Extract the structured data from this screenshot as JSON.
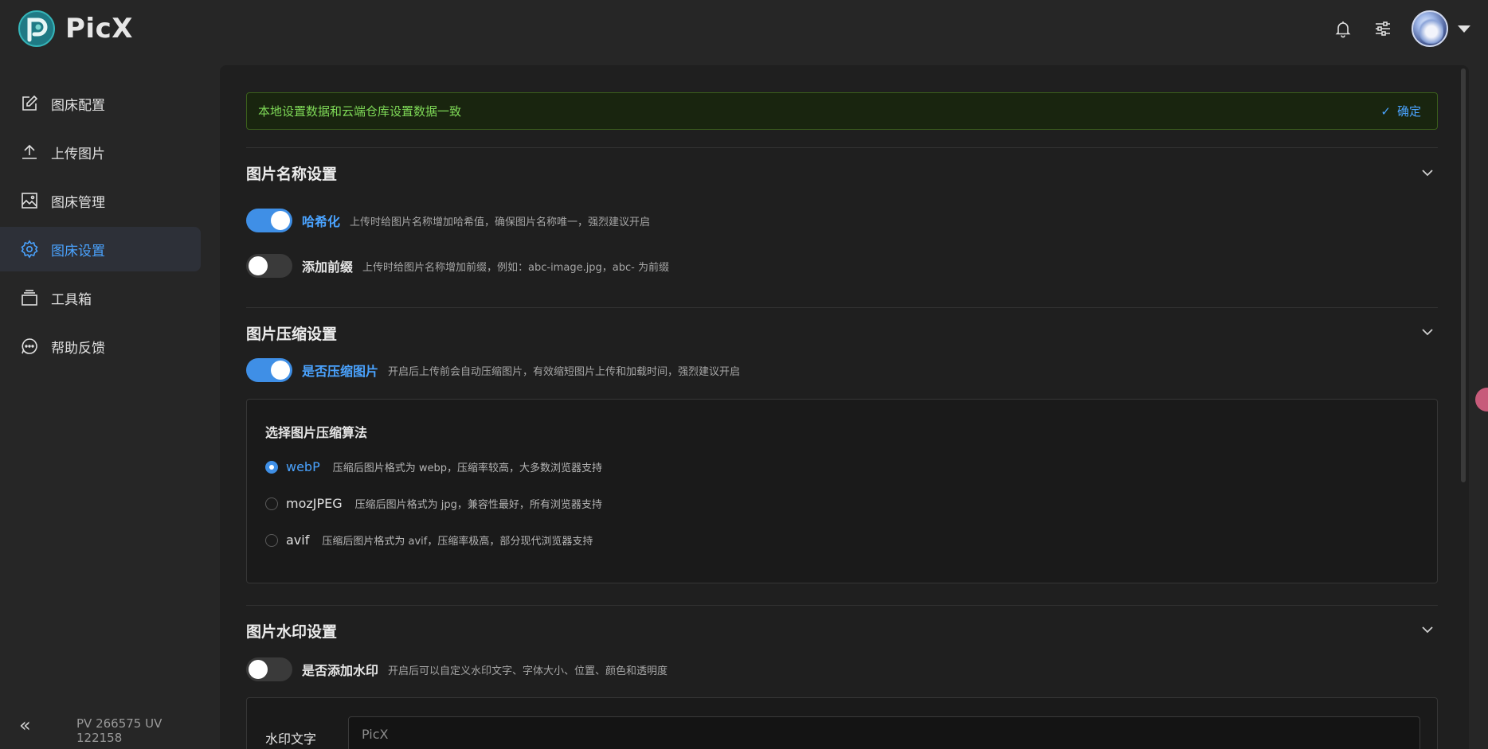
{
  "app": {
    "name": "PicX"
  },
  "header": {
    "icons": [
      "bell-icon",
      "settings-sliders-icon"
    ]
  },
  "sidebar": {
    "items": [
      {
        "label": "图床配置",
        "icon": "edit-icon"
      },
      {
        "label": "上传图片",
        "icon": "upload-icon"
      },
      {
        "label": "图床管理",
        "icon": "image-icon"
      },
      {
        "label": "图床设置",
        "icon": "gear-icon",
        "active": true
      },
      {
        "label": "工具箱",
        "icon": "toolbox-icon"
      },
      {
        "label": "帮助反馈",
        "icon": "chat-icon"
      }
    ],
    "stats": "PV 266575  UV 122158"
  },
  "alert": {
    "text": "本地设置数据和云端仓库设置数据一致",
    "confirm_label": "确定"
  },
  "name_section": {
    "title": "图片名称设置",
    "options": [
      {
        "label": "哈希化",
        "desc": "上传时给图片名称增加哈希值，确保图片名称唯一，强烈建议开启",
        "on": true
      },
      {
        "label": "添加前缀",
        "desc": "上传时给图片名称增加前缀，例如：abc-image.jpg，abc- 为前缀",
        "on": false
      }
    ]
  },
  "compress_section": {
    "title": "图片压缩设置",
    "toggle": {
      "label": "是否压缩图片",
      "desc": "开启后上传前会自动压缩图片，有效缩短图片上传和加载时间，强烈建议开启",
      "on": true
    },
    "panel_title": "选择图片压缩算法",
    "algorithms": [
      {
        "label": "webP",
        "desc": "压缩后图片格式为 webp，压缩率较高，大多数浏览器支持",
        "checked": true
      },
      {
        "label": "mozJPEG",
        "desc": "压缩后图片格式为 jpg，兼容性最好，所有浏览器支持",
        "checked": false
      },
      {
        "label": "avif",
        "desc": "压缩后图片格式为 avif，压缩率极高，部分现代浏览器支持",
        "checked": false
      }
    ]
  },
  "watermark_section": {
    "title": "图片水印设置",
    "toggle": {
      "label": "是否添加水印",
      "desc": "开启后可以自定义水印文字、字体大小、位置、颜色和透明度",
      "on": false
    },
    "text_label": "水印文字",
    "text_value": "PicX"
  },
  "colors": {
    "accent": "#3f8fe6",
    "success": "#7ed957",
    "background": "#262626",
    "panel": "#1f1f1f"
  }
}
